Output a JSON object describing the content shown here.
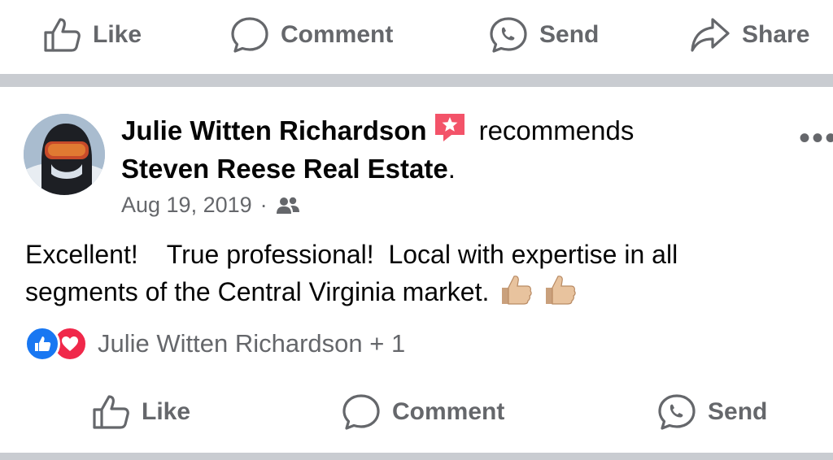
{
  "top_actions": {
    "like": "Like",
    "comment": "Comment",
    "send": "Send",
    "share": "Share"
  },
  "post": {
    "author": "Julie Witten Richardson",
    "verb": "recommends",
    "page": "Steven Reese Real Estate",
    "page_suffix": ".",
    "date": "Aug 19, 2019",
    "dot": "·",
    "more": "•••",
    "text_line1": "Excellent!    True professional!  Local with expertise in all",
    "text_line2": "segments of the Central Virginia market.",
    "reactions_text": "Julie Witten Richardson + 1"
  },
  "bottom_actions": {
    "like": "Like",
    "comment": "Comment",
    "send": "Send"
  },
  "colors": {
    "like_blue": "#1877f2",
    "love_red": "#f0284a",
    "badge_pink": "#f35369",
    "secondary_text": "#65676b",
    "separator": "#c9ccd1"
  },
  "icons": [
    "thumbs-up-icon",
    "comment-bubble-icon",
    "messenger-send-icon",
    "share-arrow-icon",
    "recommendation-badge-icon",
    "friends-audience-icon",
    "more-options-icon",
    "thumbs-up-emoji-icon",
    "love-reaction-icon"
  ]
}
